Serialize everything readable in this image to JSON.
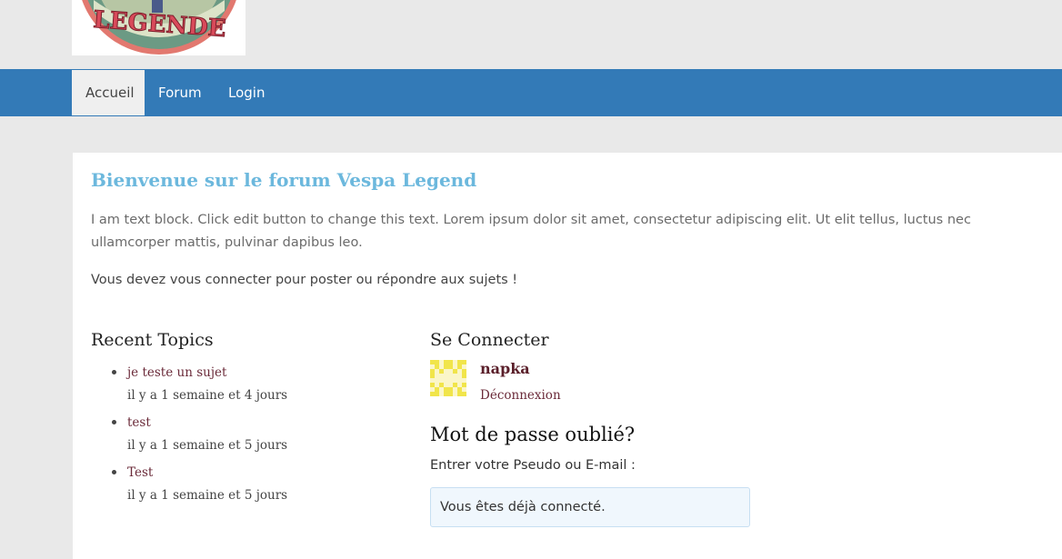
{
  "logo": {
    "text": "LEGENDE"
  },
  "nav": {
    "items": [
      {
        "label": "Accueil",
        "active": true
      },
      {
        "label": "Forum",
        "active": false
      },
      {
        "label": "Login",
        "active": false
      }
    ]
  },
  "main": {
    "title": "Bienvenue sur le forum Vespa Legend",
    "intro": "I am text block. Click edit button to change this text. Lorem ipsum dolor sit amet, consectetur adipiscing elit. Ut elit tellus, luctus nec ullamcorper mattis, pulvinar dapibus leo.",
    "notice": "Vous devez vous connecter pour poster ou répondre aux sujets !"
  },
  "recent_topics": {
    "title": "Recent Topics",
    "items": [
      {
        "title": "je teste un sujet",
        "time": "il y a 1 semaine et 4 jours"
      },
      {
        "title": "test",
        "time": "il y a 1 semaine et 5 jours"
      },
      {
        "title": "Test",
        "time": "il y a 1 semaine et 5 jours"
      }
    ]
  },
  "login_widget": {
    "title": "Se Connecter",
    "username": "napka",
    "logout_label": "Déconnexion",
    "avatar_icon": "identicon-avatar-icon"
  },
  "password_reset": {
    "title": "Mot de passe oublié?",
    "label": "Entrer votre Pseudo ou E-mail :",
    "message": "Vous êtes déjà connecté."
  },
  "colors": {
    "nav_background": "#337ab7",
    "title_color": "#6cb8dd",
    "link_color": "#6b2b3a",
    "page_background": "#e9e9e9"
  }
}
